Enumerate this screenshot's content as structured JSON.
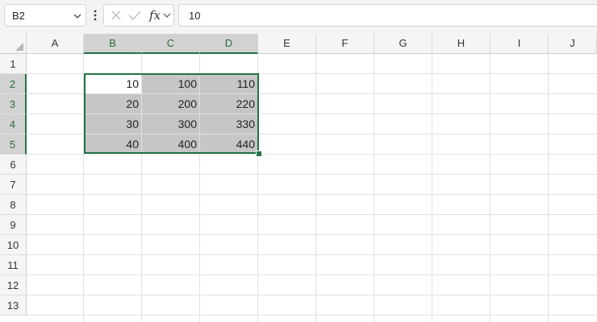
{
  "formula_bar": {
    "name_box": "B2",
    "formula_value": "10",
    "fx_label": "fx",
    "icons": [
      "name-box-dropdown-chevron",
      "more-options-kebab",
      "cancel-x",
      "enter-check",
      "insert-function-fx",
      "function-dropdown-chevron"
    ]
  },
  "columns": [
    "A",
    "B",
    "C",
    "D",
    "E",
    "F",
    "G",
    "H",
    "I",
    "J"
  ],
  "selected_columns": [
    "B",
    "C",
    "D"
  ],
  "rows": [
    "1",
    "2",
    "3",
    "4",
    "5",
    "6",
    "7",
    "8",
    "9",
    "10",
    "11",
    "12",
    "13"
  ],
  "selected_rows": [
    "2",
    "3",
    "4",
    "5"
  ],
  "active_cell": "B2",
  "selected_range": "B2:D5",
  "cells": [
    {
      "ref": "B2",
      "value": "10"
    },
    {
      "ref": "C2",
      "value": "100"
    },
    {
      "ref": "D2",
      "value": "110"
    },
    {
      "ref": "B3",
      "value": "20"
    },
    {
      "ref": "C3",
      "value": "200"
    },
    {
      "ref": "D3",
      "value": "220"
    },
    {
      "ref": "B4",
      "value": "30"
    },
    {
      "ref": "C4",
      "value": "300"
    },
    {
      "ref": "D4",
      "value": "330"
    },
    {
      "ref": "B5",
      "value": "40"
    },
    {
      "ref": "C5",
      "value": "400"
    },
    {
      "ref": "D5",
      "value": "440"
    }
  ],
  "colors": {
    "selection_accent": "#217346",
    "selection_fill": "#c6c6c6",
    "header_selected_fill": "#d2d2d2",
    "gridline": "#e1e1e1"
  }
}
